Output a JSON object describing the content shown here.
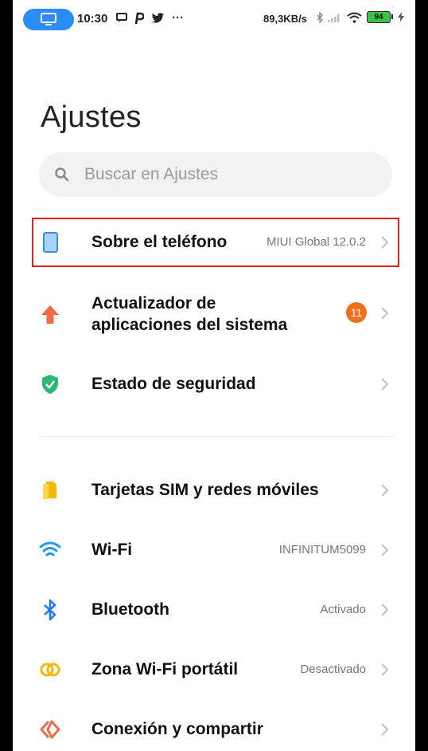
{
  "status_bar": {
    "time": "10:30",
    "speed": "89,3KB/s",
    "battery": "94",
    "more": "···"
  },
  "page": {
    "title": "Ajustes"
  },
  "search": {
    "placeholder": "Buscar en Ajustes"
  },
  "items": [
    {
      "label": "Sobre el teléfono",
      "value": "MIUI Global 12.0.2",
      "icon": "phone-icon"
    },
    {
      "label_line1": "Actualizador de",
      "label_line2": "aplicaciones del sistema",
      "badge": "11",
      "icon": "update-arrow-icon"
    },
    {
      "label": "Estado de seguridad",
      "icon": "shield-check-icon"
    },
    {
      "label": "Tarjetas SIM y redes móviles",
      "icon": "sim-card-icon"
    },
    {
      "label": "Wi-Fi",
      "value": "INFINITUM5099",
      "icon": "wifi-icon"
    },
    {
      "label": "Bluetooth",
      "value": "Activado",
      "icon": "bluetooth-icon"
    },
    {
      "label": "Zona Wi-Fi portátil",
      "value": "Desactivado",
      "icon": "hotspot-icon"
    },
    {
      "label": "Conexión y compartir",
      "icon": "connection-share-icon"
    }
  ],
  "colors": {
    "highlight_border": "#e02020",
    "badge": "#f3701b",
    "accent_blue": "#2a8cf5"
  }
}
